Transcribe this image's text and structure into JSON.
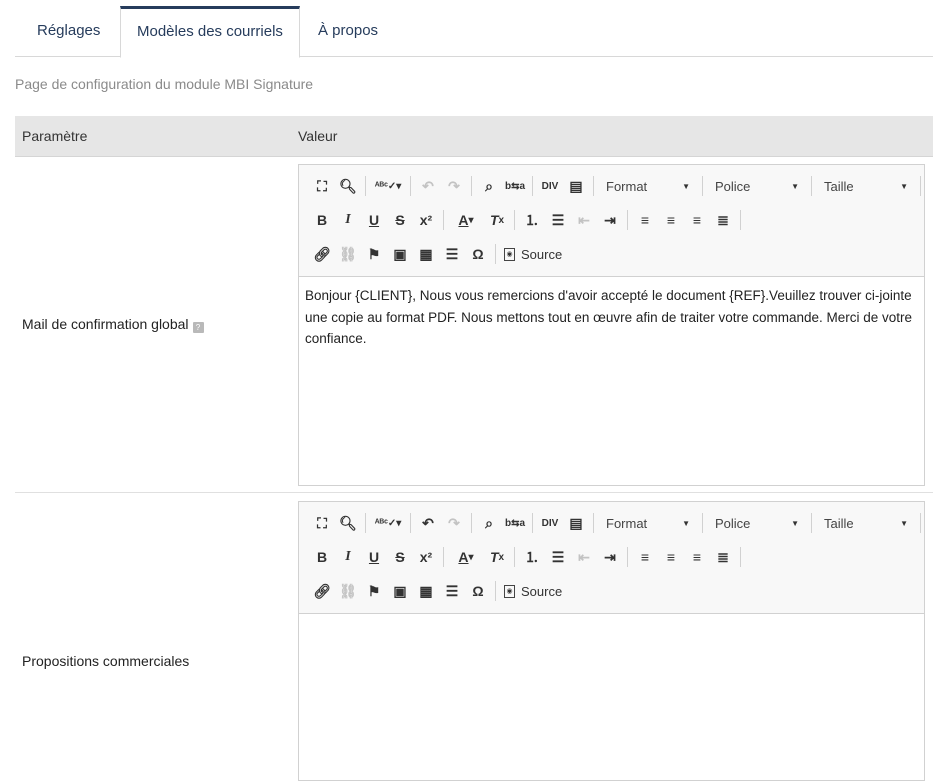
{
  "tabs": [
    {
      "label": "Réglages"
    },
    {
      "label": "Modèles des courriels"
    },
    {
      "label": "À propos"
    }
  ],
  "subtitle": "Page de configuration du module MBI Signature",
  "table": {
    "col_param": "Paramètre",
    "col_value": "Valeur"
  },
  "editor_toolbar": {
    "format_label": "Format",
    "font_label": "Police",
    "size_label": "Taille",
    "source_label": "Source"
  },
  "rows": [
    {
      "label": "Mail de confirmation global",
      "content": "Bonjour {CLIENT}, Nous vous remercions d'avoir accepté le document {REF}.Veuillez trouver ci-jointe une copie au format PDF. Nous mettons tout en œuvre afin de traiter votre commande. Merci de votre confiance."
    },
    {
      "label": "Propositions commerciales",
      "content": ""
    }
  ],
  "colors": {
    "accent": "#263c5c",
    "header_bg": "#e6e6e6",
    "toolbar_bg": "#f8f8f8"
  }
}
